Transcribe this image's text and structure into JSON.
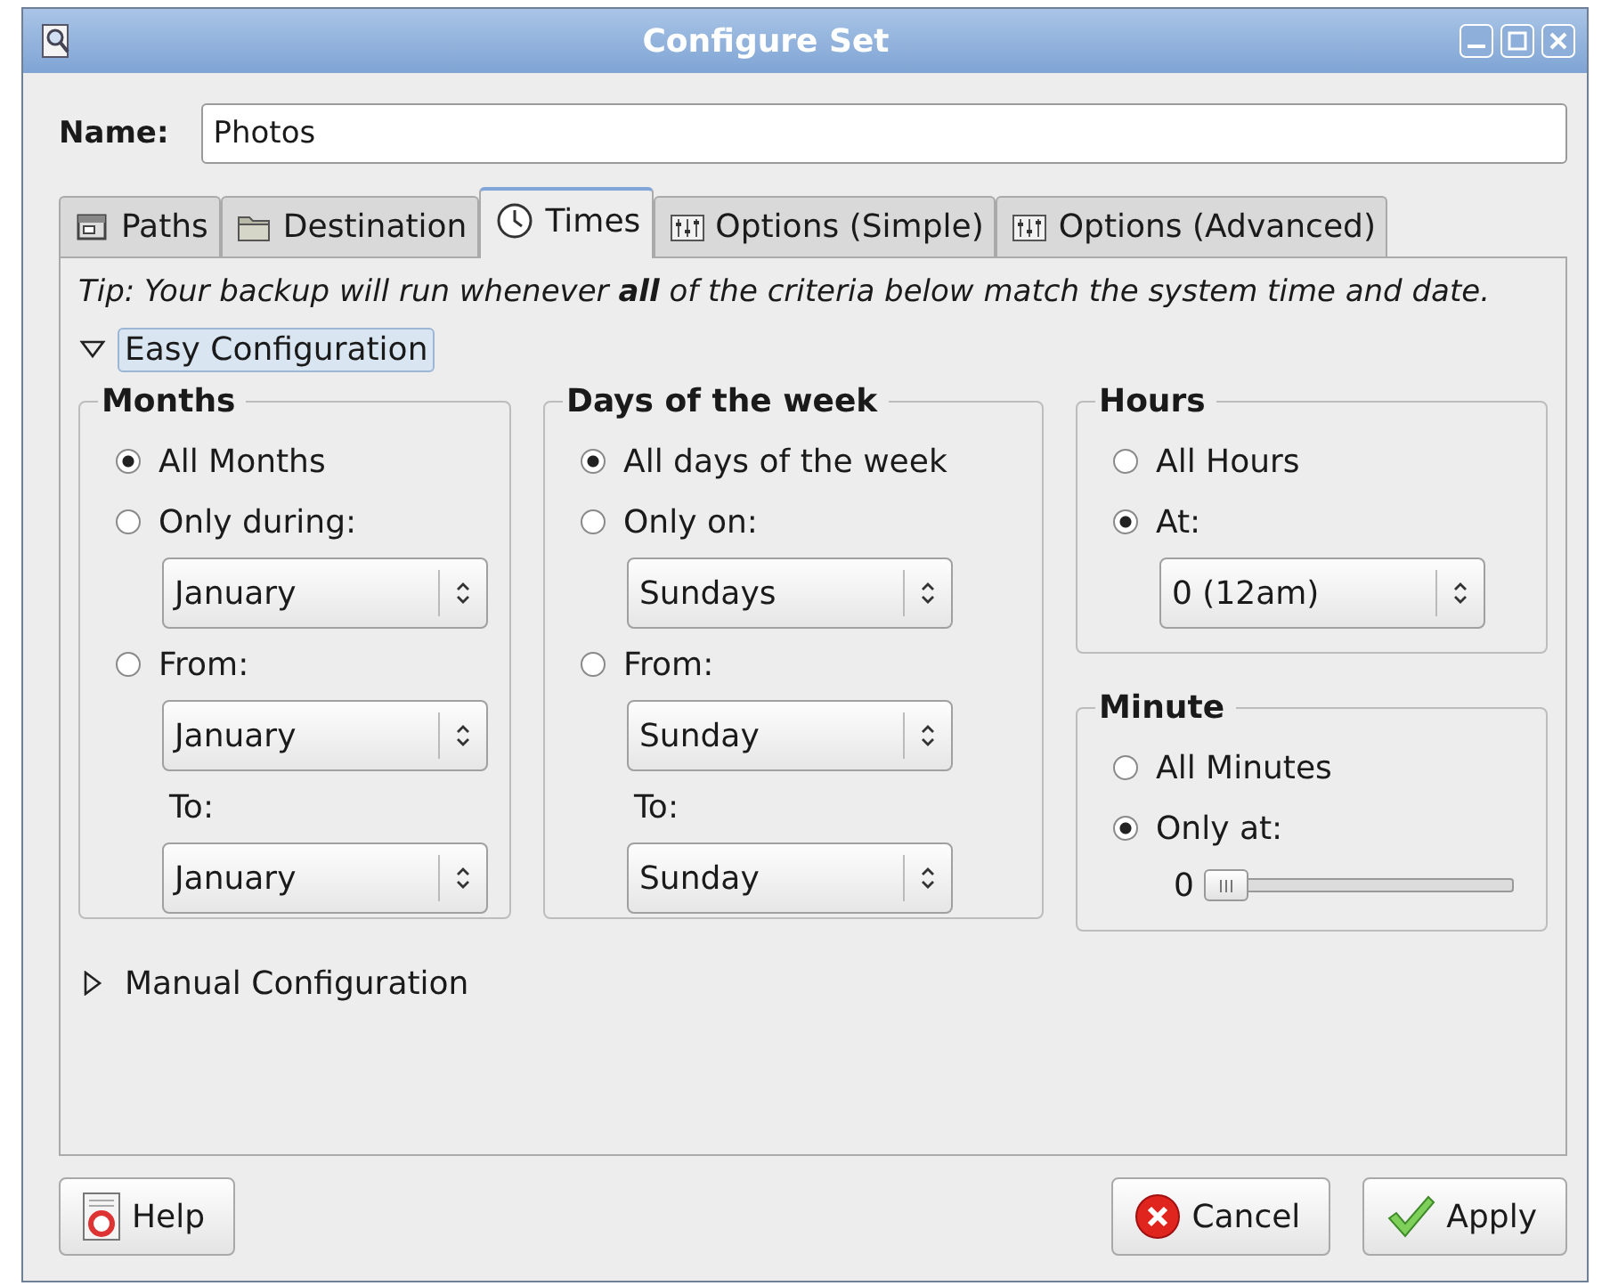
{
  "window": {
    "title": "Configure Set"
  },
  "name": {
    "label": "Name:",
    "value": "Photos"
  },
  "tabs": [
    {
      "label": "Paths",
      "kind": "panel",
      "selected": false
    },
    {
      "label": "Destination",
      "kind": "folder",
      "selected": false
    },
    {
      "label": "Times",
      "kind": "clock",
      "selected": true
    },
    {
      "label": "Options (Simple)",
      "kind": "sliders",
      "selected": false
    },
    {
      "label": "Options (Advanced)",
      "kind": "sliders",
      "selected": false
    }
  ],
  "tip": "Tip: Your backup will run whenever **all** of the criteria below match the system time and date.",
  "easy_configuration": {
    "label": "Easy Configuration",
    "expanded": true,
    "selected": true
  },
  "columns": [
    [
      {
        "title": "Months",
        "rows": [
          {
            "kind": "radio",
            "label": "All Months",
            "selected": true
          },
          {
            "kind": "radio",
            "label": "Only during:",
            "selected": false
          },
          {
            "kind": "combo",
            "value": "January"
          },
          {
            "kind": "radio",
            "label": "From:",
            "selected": false
          },
          {
            "kind": "combo",
            "value": "January"
          },
          {
            "kind": "label",
            "label": "To:"
          },
          {
            "kind": "combo",
            "value": "January"
          }
        ]
      }
    ],
    [
      {
        "title": "Days of the week",
        "rows": [
          {
            "kind": "radio",
            "label": "All days of the week",
            "selected": true
          },
          {
            "kind": "radio",
            "label": "Only on:",
            "selected": false
          },
          {
            "kind": "combo",
            "value": "Sundays"
          },
          {
            "kind": "radio",
            "label": "From:",
            "selected": false
          },
          {
            "kind": "combo",
            "value": "Sunday"
          },
          {
            "kind": "label",
            "label": "To:"
          },
          {
            "kind": "combo",
            "value": "Sunday"
          }
        ]
      }
    ],
    [
      {
        "title": "Hours",
        "rows": [
          {
            "kind": "radio",
            "label": "All Hours",
            "selected": false
          },
          {
            "kind": "radio",
            "label": "At:",
            "selected": true
          },
          {
            "kind": "combo",
            "value": "0 (12am)"
          }
        ]
      },
      {
        "title": "Minute",
        "rows": [
          {
            "kind": "radio",
            "label": "All Minutes",
            "selected": false
          },
          {
            "kind": "radio",
            "label": "Only at:",
            "selected": true
          },
          {
            "kind": "slider",
            "reading": "0",
            "level": 0
          }
        ]
      }
    ]
  ],
  "manual_configuration": {
    "label": "Manual Configuration",
    "expanded": false
  },
  "buttons": [
    {
      "label": "Help",
      "kind": "help"
    },
    {
      "label": "Cancel",
      "kind": "cancel"
    },
    {
      "label": "Apply",
      "kind": "apply"
    }
  ]
}
